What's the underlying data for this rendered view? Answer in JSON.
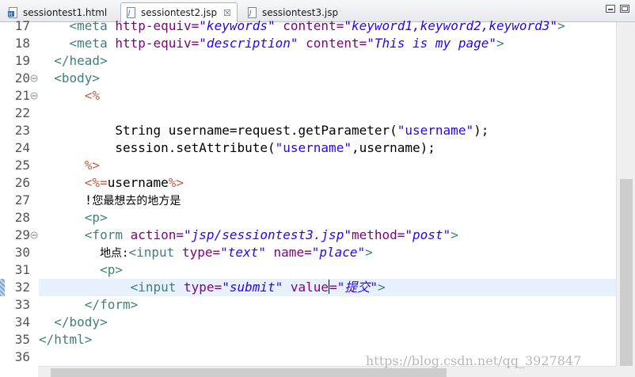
{
  "tabs": [
    {
      "label": "sessiontest1.html",
      "active": false,
      "closable": false,
      "icon": "html-file-icon"
    },
    {
      "label": "sessiontest2.jsp",
      "active": true,
      "closable": true,
      "icon": "jsp-file-icon"
    },
    {
      "label": "sessiontest3.jsp",
      "active": false,
      "closable": false,
      "icon": "jsp-file-icon"
    }
  ],
  "tab_close_glyph": "☒",
  "lines": [
    {
      "n": "17",
      "fold": false,
      "tokens": [
        {
          "t": "    ",
          "c": ""
        },
        {
          "t": "<meta ",
          "c": "tag"
        },
        {
          "t": "http-equiv=",
          "c": "attr"
        },
        {
          "t": "\"keywords\"",
          "c": "val"
        },
        {
          "t": " content=",
          "c": "attr"
        },
        {
          "t": "\"keyword1,keyword2,keyword3\"",
          "c": "val"
        },
        {
          "t": ">",
          "c": "tag"
        }
      ]
    },
    {
      "n": "18",
      "fold": false,
      "tokens": [
        {
          "t": "    ",
          "c": ""
        },
        {
          "t": "<meta ",
          "c": "tag"
        },
        {
          "t": "http-equiv=",
          "c": "attr"
        },
        {
          "t": "\"description\"",
          "c": "val"
        },
        {
          "t": " content=",
          "c": "attr"
        },
        {
          "t": "\"This is my page\"",
          "c": "val"
        },
        {
          "t": ">",
          "c": "tag"
        }
      ]
    },
    {
      "n": "19",
      "fold": false,
      "tokens": [
        {
          "t": "  ",
          "c": ""
        },
        {
          "t": "</head>",
          "c": "tag"
        }
      ]
    },
    {
      "n": "20",
      "fold": true,
      "tokens": [
        {
          "t": "  ",
          "c": ""
        },
        {
          "t": "<body>",
          "c": "tag"
        }
      ]
    },
    {
      "n": "21",
      "fold": true,
      "tokens": [
        {
          "t": "      ",
          "c": ""
        },
        {
          "t": "<%",
          "c": "jspd"
        }
      ]
    },
    {
      "n": "22",
      "fold": false,
      "tokens": []
    },
    {
      "n": "23",
      "fold": false,
      "tokens": [
        {
          "t": "          String username=request.getParameter(",
          "c": ""
        },
        {
          "t": "\"username\"",
          "c": "str"
        },
        {
          "t": ");",
          "c": ""
        }
      ]
    },
    {
      "n": "24",
      "fold": false,
      "tokens": [
        {
          "t": "          session.setAttribute(",
          "c": ""
        },
        {
          "t": "\"username\"",
          "c": "str"
        },
        {
          "t": ",username);",
          "c": ""
        }
      ]
    },
    {
      "n": "25",
      "fold": false,
      "tokens": [
        {
          "t": "      ",
          "c": ""
        },
        {
          "t": "%>",
          "c": "jspd"
        }
      ]
    },
    {
      "n": "26",
      "fold": false,
      "tokens": [
        {
          "t": "      ",
          "c": ""
        },
        {
          "t": "<%=",
          "c": "jspd"
        },
        {
          "t": "username",
          "c": ""
        },
        {
          "t": "%>",
          "c": "jspd"
        }
      ]
    },
    {
      "n": "27",
      "fold": false,
      "tokens": [
        {
          "t": "      !",
          "c": ""
        },
        {
          "t": "您最想去的地方是",
          "c": "cjk"
        }
      ]
    },
    {
      "n": "28",
      "fold": false,
      "tokens": [
        {
          "t": "      ",
          "c": ""
        },
        {
          "t": "<p>",
          "c": "tag"
        }
      ]
    },
    {
      "n": "29",
      "fold": true,
      "tokens": [
        {
          "t": "      ",
          "c": ""
        },
        {
          "t": "<form ",
          "c": "tag"
        },
        {
          "t": "action=",
          "c": "attr"
        },
        {
          "t": "\"jsp/sessiontest3.jsp\"",
          "c": "val"
        },
        {
          "t": "method=",
          "c": "attr"
        },
        {
          "t": "\"post\"",
          "c": "val"
        },
        {
          "t": ">",
          "c": "tag"
        }
      ]
    },
    {
      "n": "30",
      "fold": false,
      "tokens": [
        {
          "t": "        ",
          "c": ""
        },
        {
          "t": "地点:",
          "c": "cjk"
        },
        {
          "t": "<input ",
          "c": "tag"
        },
        {
          "t": "type=",
          "c": "attr"
        },
        {
          "t": "\"text\"",
          "c": "val"
        },
        {
          "t": " name=",
          "c": "attr"
        },
        {
          "t": "\"place\"",
          "c": "val"
        },
        {
          "t": ">",
          "c": "tag"
        }
      ]
    },
    {
      "n": "31",
      "fold": false,
      "tokens": [
        {
          "t": "        ",
          "c": ""
        },
        {
          "t": "<p>",
          "c": "tag"
        }
      ]
    },
    {
      "n": "32",
      "fold": false,
      "current": true,
      "bookmark": true,
      "tokens": [
        {
          "t": "            ",
          "c": ""
        },
        {
          "t": "<input ",
          "c": "tag"
        },
        {
          "t": "type=",
          "c": "attr"
        },
        {
          "t": "\"submit\"",
          "c": "val"
        },
        {
          "t": " value",
          "c": "attr"
        },
        {
          "t": "|",
          "c": "caret"
        },
        {
          "t": "=",
          "c": "attr"
        },
        {
          "t": "\"提交\"",
          "c": "val"
        },
        {
          "t": ">",
          "c": "tag"
        }
      ]
    },
    {
      "n": "33",
      "fold": false,
      "tokens": [
        {
          "t": "      ",
          "c": ""
        },
        {
          "t": "</form>",
          "c": "tag"
        }
      ]
    },
    {
      "n": "34",
      "fold": false,
      "tokens": [
        {
          "t": "  ",
          "c": ""
        },
        {
          "t": "</body>",
          "c": "tag"
        }
      ]
    },
    {
      "n": "35",
      "fold": false,
      "tokens": [
        {
          "t": "</html>",
          "c": "tag"
        }
      ]
    },
    {
      "n": "36",
      "fold": false,
      "tokens": []
    }
  ],
  "watermark": "https://blog.csdn.net/qq_3927847",
  "colors": {
    "tag": "#3f7f7f",
    "attribute": "#7f007f",
    "attribute_value": "#2a00ff",
    "jsp_delimiter": "#bf5f3f",
    "current_line": "#e8f2fe"
  }
}
